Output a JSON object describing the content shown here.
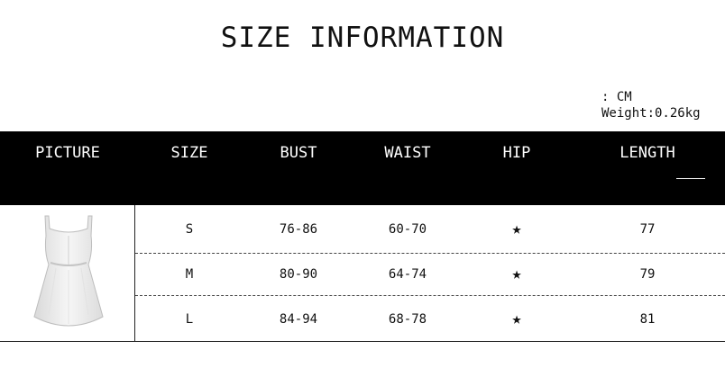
{
  "title": "SIZE INFORMATION",
  "meta": {
    "unit": ": CM",
    "weight": "Weight:0.26kg"
  },
  "headers": [
    "PICTURE",
    "SIZE",
    "BUST",
    "WAIST",
    "HIP",
    "LENGTH"
  ],
  "rows": [
    {
      "size": "S",
      "bust": "76-86",
      "waist": "60-70",
      "hip": "★",
      "length": "77"
    },
    {
      "size": "M",
      "bust": "80-90",
      "waist": "64-74",
      "hip": "★",
      "length": "79"
    },
    {
      "size": "L",
      "bust": "84-94",
      "waist": "68-78",
      "hip": "★",
      "length": "81"
    }
  ],
  "icons": {
    "hip": "star-icon",
    "picture": "dress-image"
  },
  "colors": {
    "header_bg": "#000000",
    "header_text": "#ffffff"
  }
}
